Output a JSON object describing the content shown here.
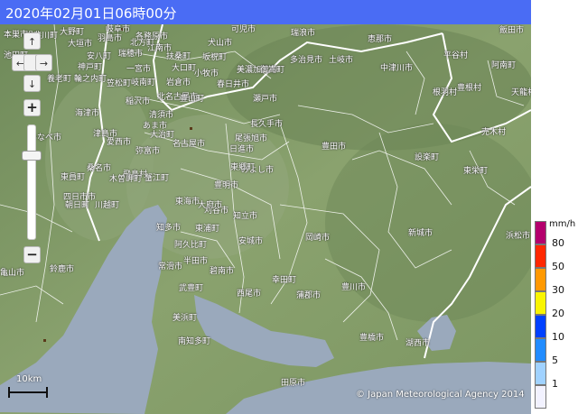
{
  "header": {
    "title": "2020年02月01日06時00分",
    "bg_color": "#4a6cf4"
  },
  "map": {
    "scale_label": "10km",
    "copyright": "© Japan Meteorological Agency 2014",
    "nav": {
      "up": "↑",
      "left": "←",
      "right": "→",
      "down": "↓"
    },
    "zoom": {
      "in": "+",
      "out": "−"
    },
    "land_color": "#7f9a66",
    "water_color": "#9aa9bc",
    "boundary_color": "#ffffff",
    "cities": [
      "一宮市",
      "犬山市",
      "春日井市",
      "尾張旭市",
      "瀬戸市",
      "豊田市",
      "岡崎市",
      "名古屋市",
      "豊橋市",
      "豊川市",
      "新城市",
      "設楽町",
      "東栄町",
      "豊根村",
      "田原市",
      "蒲郡市",
      "西尾市",
      "半田市",
      "常滑市",
      "碧南市",
      "安城市",
      "知立市",
      "刈谷市",
      "東海市",
      "大府市",
      "東浦町",
      "知多市",
      "武豊町",
      "美浜町",
      "南知多町",
      "阿久比町",
      "幸田町",
      "みよし市",
      "豊明市",
      "日進市",
      "長久手市",
      "東郷町",
      "小牧市",
      "岩倉市",
      "北名古屋市",
      "清須市",
      "稲沢市",
      "津島市",
      "愛西市",
      "弥富市",
      "飛島村",
      "蟹江町",
      "大治町",
      "あま市",
      "江南市",
      "扶桑町",
      "大口町",
      "羽島市",
      "大垣市",
      "岐阜市",
      "各務原市",
      "可児市",
      "多治見市",
      "土岐市",
      "瑞浪市",
      "恵那市",
      "平谷村",
      "根羽村",
      "売木村",
      "阿南町",
      "天龍村",
      "浜松市",
      "湖西市",
      "豊山町",
      "桑名市",
      "四日市市",
      "木曽岬町",
      "朝日町",
      "川越町",
      "東員町",
      "いなべ市",
      "鈴鹿市",
      "亀山市",
      "海津市",
      "養老町",
      "輪之内町",
      "安八町",
      "神戸町",
      "揖斐川町",
      "大野町",
      "池田町",
      "本巣市",
      "瑞穂市",
      "北方町",
      "笠松町",
      "岐南町",
      "坂祝町",
      "美濃加茂市",
      "御嵩町",
      "中津川市",
      "飯田市"
    ]
  },
  "legend": {
    "unit": "mm/h",
    "levels": [
      {
        "label": "80",
        "color": "#b4006d"
      },
      {
        "label": "50",
        "color": "#ff2800"
      },
      {
        "label": "30",
        "color": "#ff9900"
      },
      {
        "label": "20",
        "color": "#faf500"
      },
      {
        "label": "10",
        "color": "#0041ff"
      },
      {
        "label": "5",
        "color": "#218cff"
      },
      {
        "label": "1",
        "color": "#a0d2ff"
      },
      {
        "label": "",
        "color": "#f2f2ff"
      }
    ]
  }
}
